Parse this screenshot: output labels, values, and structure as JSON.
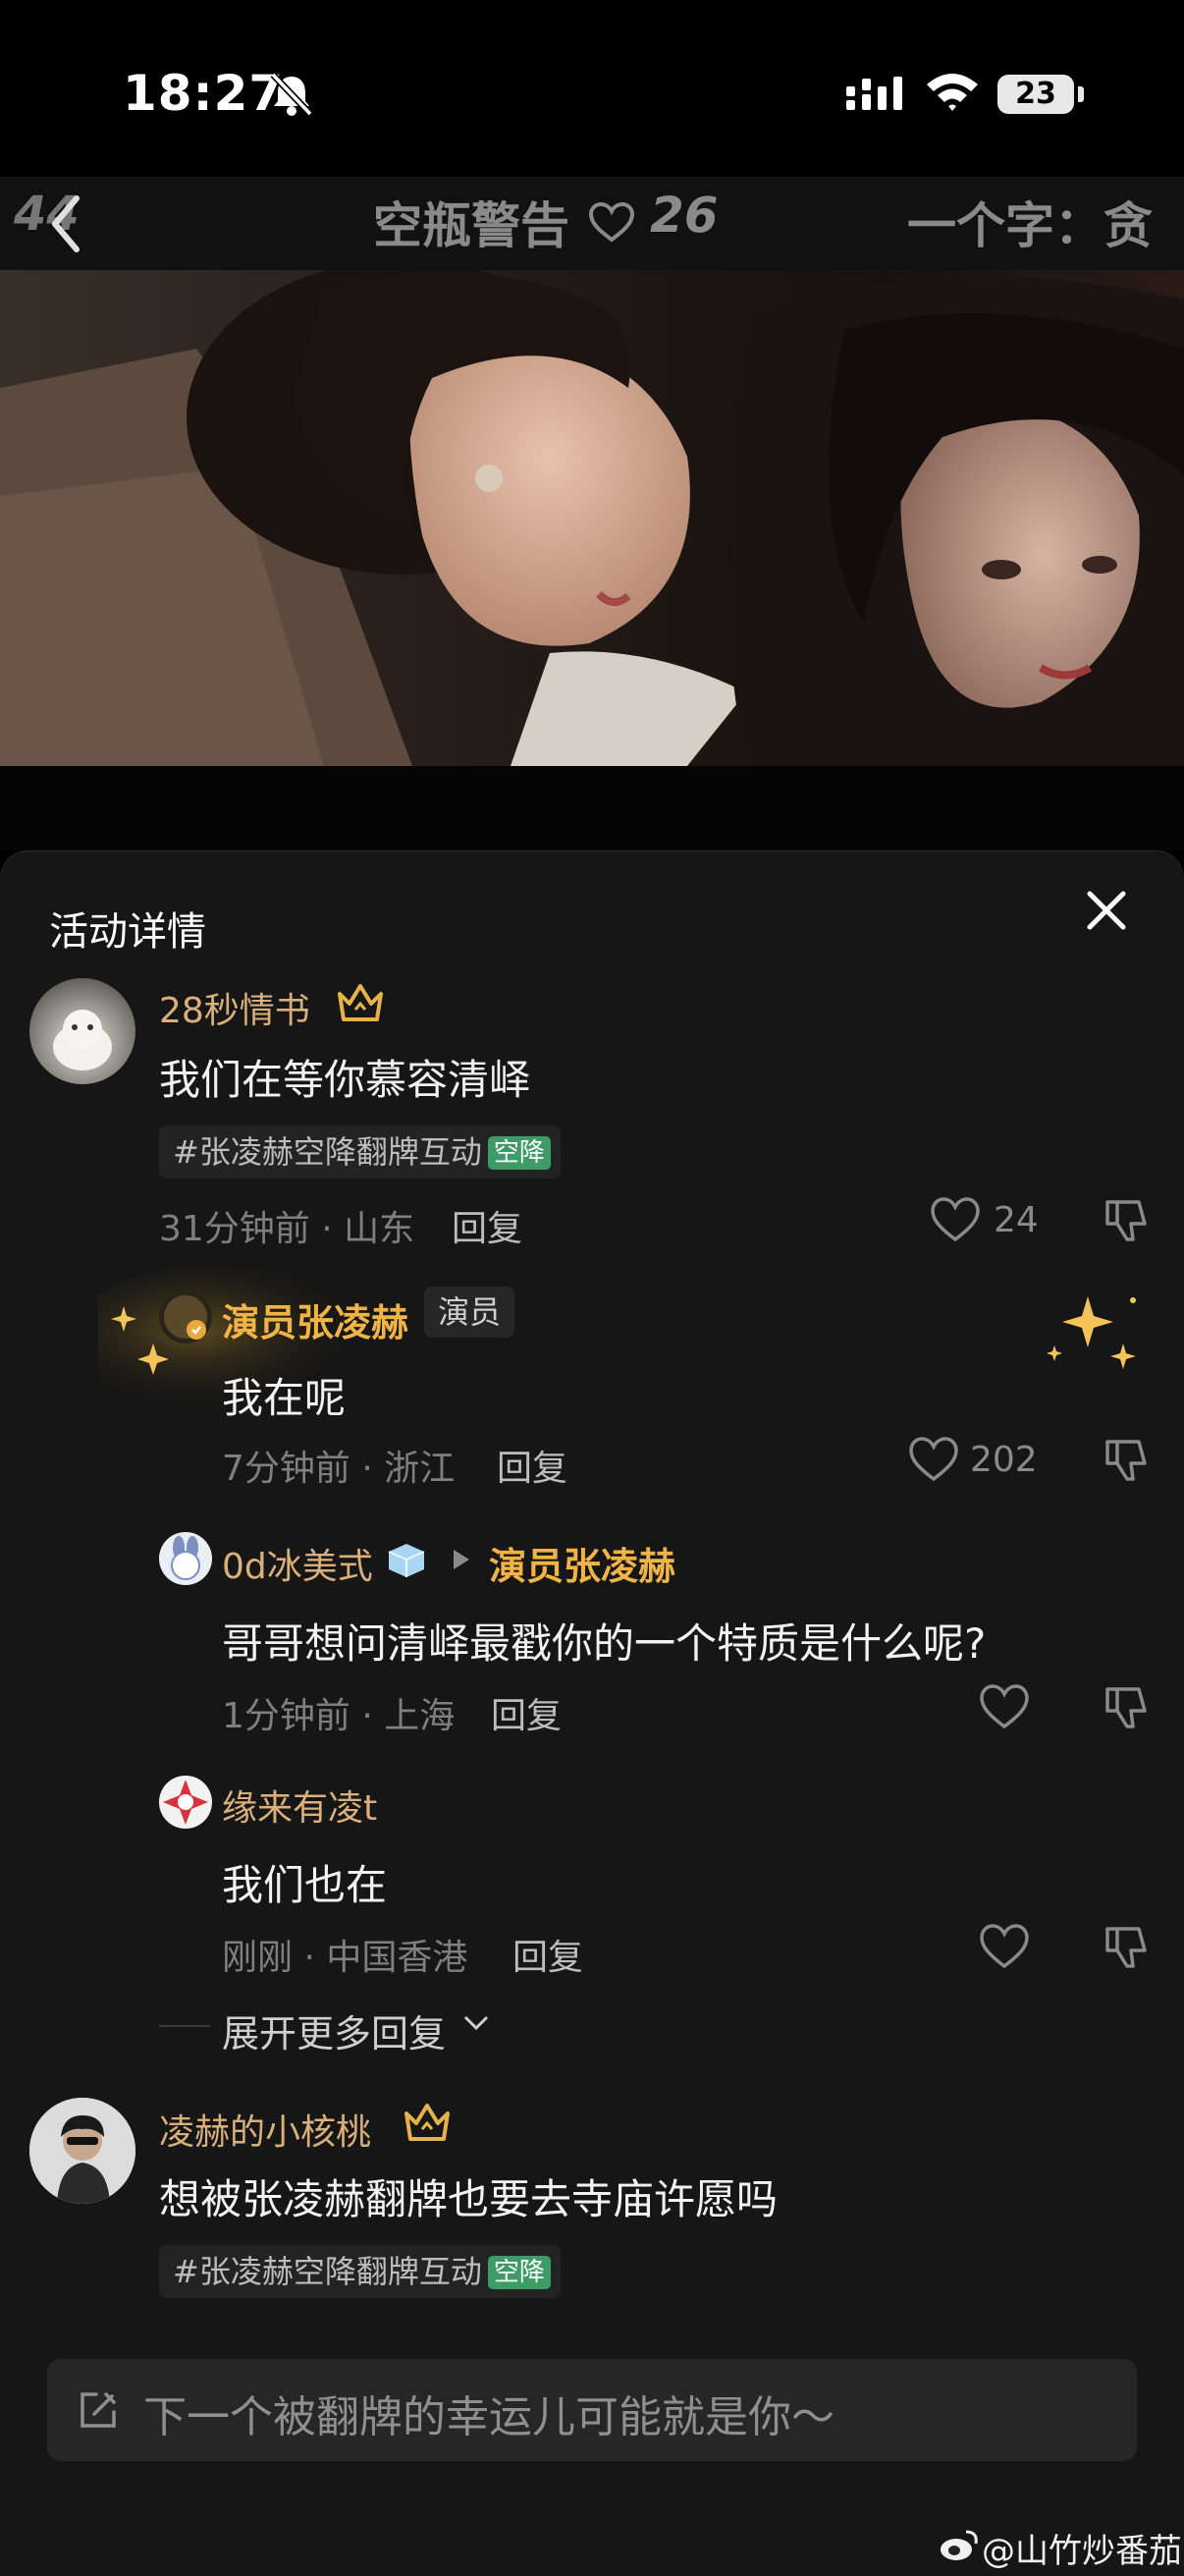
{
  "status_bar": {
    "time": "18:27",
    "battery": "23"
  },
  "top_bar": {
    "prev_episode_number": "44",
    "title": "空瓶警告",
    "like_count": "26",
    "next_title": "一个字：贪"
  },
  "sheet": {
    "title": "活动详情"
  },
  "comments": [
    {
      "user": "28秒情书",
      "text": "我们在等你慕容清峄",
      "tag": "#张凌赫空降翻牌互动",
      "tag_badge": "空降",
      "meta": "31分钟前 · 山东",
      "reply_label": "回复",
      "likes": "24"
    },
    {
      "user": "凌赫的小核桃",
      "text": "想被张凌赫翻牌也要去寺庙许愿吗",
      "tag": "#张凌赫空降翻牌互动",
      "tag_badge": "空降"
    }
  ],
  "replies": [
    {
      "user": "演员张凌赫",
      "badge": "演员",
      "text": "我在呢",
      "meta": "7分钟前 · 浙江",
      "reply_label": "回复",
      "likes": "202"
    },
    {
      "user": "0d冰美式",
      "target": "演员张凌赫",
      "text": "哥哥想问清峄最戳你的一个特质是什么呢?",
      "meta": "1分钟前 · 上海",
      "reply_label": "回复"
    },
    {
      "user": "缘来有凌t",
      "text": "我们也在",
      "meta": "刚刚 · 中国香港",
      "reply_label": "回复"
    }
  ],
  "expand_more": "展开更多回复",
  "input": {
    "placeholder": "下一个被翻牌的幸运儿可能就是你～"
  },
  "watermark": "@山竹炒番茄",
  "colors": {
    "sheet_bg": "#161616",
    "name": "#d9b07a",
    "star_name": "#f0b446",
    "badge_green": "#3d9c66"
  }
}
